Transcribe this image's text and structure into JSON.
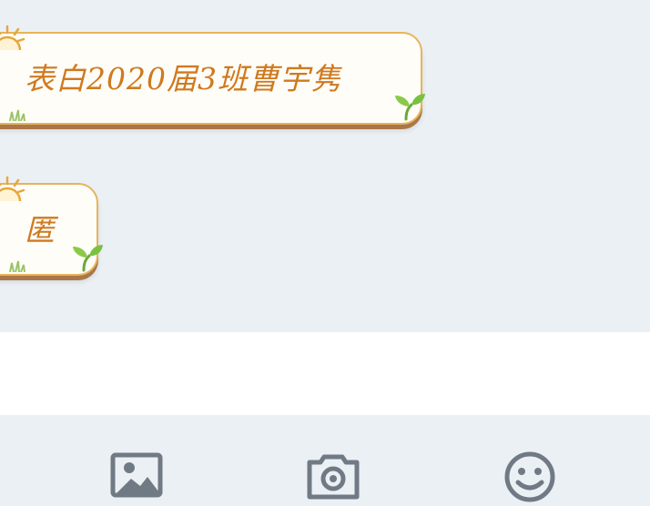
{
  "chat": {
    "messages": [
      {
        "text": "表白2020届3班曹宇隽"
      },
      {
        "text": "匿"
      }
    ]
  },
  "input": {
    "value": ""
  },
  "toolbar": {
    "buttons": [
      {
        "icon": "image-icon"
      },
      {
        "icon": "camera-icon"
      },
      {
        "icon": "emoji-icon"
      }
    ]
  },
  "colors": {
    "background": "#ebf0f5",
    "bubble_border": "#e7b45a",
    "bubble_text": "#cf7a1f",
    "bubble_shadow": "#a9774a",
    "sprout_green": "#7ac142",
    "icon_gray": "#707a85"
  }
}
